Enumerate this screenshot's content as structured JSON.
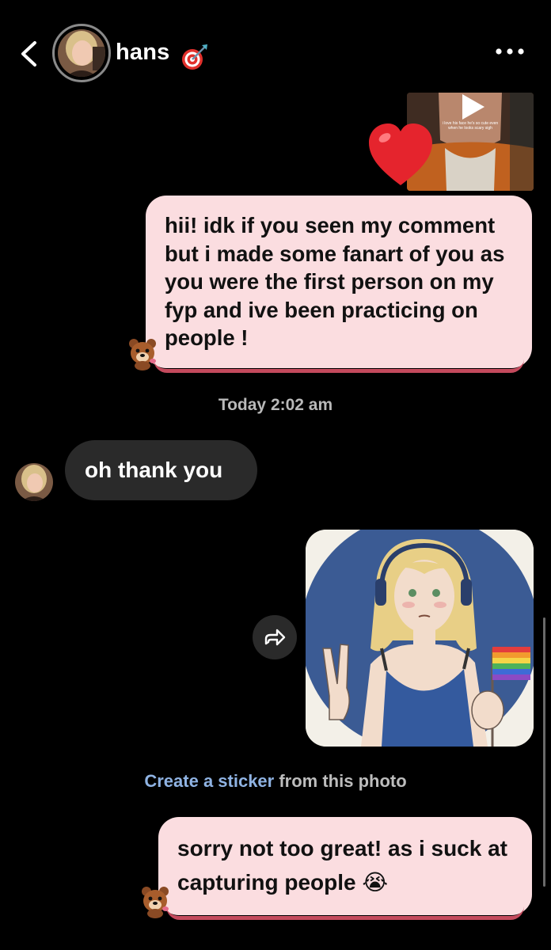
{
  "header": {
    "contact_name": "hans",
    "status_emoji_icon": "bullseye-icon",
    "back_icon": "chevron-left-icon",
    "more_icon": "more-horizontal-icon"
  },
  "reply_preview": {
    "caption": "i love his face he's so cute even when he looks scary sigh",
    "play_icon": "play-icon",
    "reaction_icon": "red-heart-icon"
  },
  "messages": [
    {
      "direction": "out",
      "text": "hii! idk if you seen my comment but i made some fanart of you as you were the first person on my fyp and ive been practicing on people !"
    },
    {
      "direction": "in",
      "text": "oh thank you"
    },
    {
      "direction": "out",
      "type": "photo",
      "description_icon": "fanart-photo"
    },
    {
      "direction": "out",
      "text": "sorry not too great! as i suck at capturing people 😭"
    }
  ],
  "timestamp": "Today 2:02 am",
  "sticker_prompt": {
    "link": "Create a sticker",
    "rest": " from this photo"
  },
  "colors": {
    "background": "#000000",
    "outgoing_bubble": "#fbdde0",
    "outgoing_border": "#c44a5d",
    "incoming_bubble": "#2a2a2a",
    "link": "#8fb3e3"
  }
}
